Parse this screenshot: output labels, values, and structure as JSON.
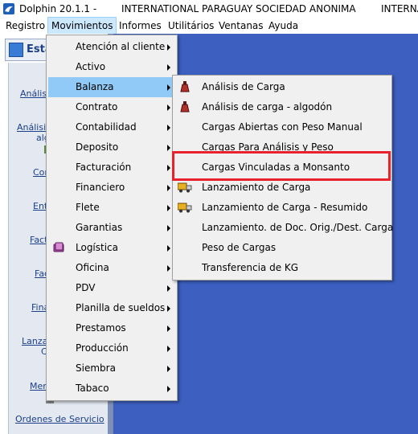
{
  "window": {
    "app_title": "Dolphin 20.1.1 -",
    "company": "INTERNATIONAL PARAGUAY SOCIEDAD ANONIMA",
    "company_truncated": "INTERNA"
  },
  "menubar": {
    "items": [
      "Registro",
      "Movimientos",
      "Informes",
      "Utilitários",
      "Ventanas",
      "Ayuda"
    ]
  },
  "sidebar": {
    "header": "Esta",
    "entries": [
      "Análisis",
      "Análisis",
      "algo",
      "Cor",
      "Entr",
      "Fact",
      "Fac",
      "Fina",
      "Lanzar",
      "C",
      "Merc",
      "Ordenes de Servicio"
    ]
  },
  "movimientos_menu": {
    "items": [
      {
        "label": "Atención al cliente",
        "submenu": true
      },
      {
        "label": "Activo",
        "submenu": true
      },
      {
        "label": "Balanza",
        "submenu": true,
        "highlight": true
      },
      {
        "label": "Contrato",
        "submenu": true
      },
      {
        "label": "Contabilidad",
        "submenu": true
      },
      {
        "label": "Deposito",
        "submenu": true
      },
      {
        "label": "Facturación",
        "submenu": true
      },
      {
        "label": "Financiero",
        "submenu": true
      },
      {
        "label": "Flete",
        "submenu": true
      },
      {
        "label": "Garantias",
        "submenu": true
      },
      {
        "label": "Logística",
        "submenu": true,
        "icon": "book-icon"
      },
      {
        "label": "Oficina",
        "submenu": true
      },
      {
        "label": "PDV",
        "submenu": true
      },
      {
        "label": "Planilla de sueldos",
        "submenu": true
      },
      {
        "label": "Prestamos",
        "submenu": true
      },
      {
        "label": "Producción",
        "submenu": true
      },
      {
        "label": "Siembra",
        "submenu": true
      },
      {
        "label": "Tabaco",
        "submenu": true
      }
    ]
  },
  "balanza_menu": {
    "items": [
      {
        "label": "Análisis de Carga",
        "icon": "flask-icon"
      },
      {
        "label": "Análisis de carga - algodón",
        "icon": "flask-icon"
      },
      {
        "label": "Cargas Abiertas con Peso Manual"
      },
      {
        "label": "Cargas Para Análisis y Peso"
      },
      {
        "label": "Cargas Vinculadas a Monsanto"
      },
      {
        "label": "Lanzamiento de Carga",
        "icon": "truck-icon"
      },
      {
        "label": "Lanzamiento de Carga - Resumido",
        "icon": "truck-icon"
      },
      {
        "label": "Lanzamiento. de Doc. Orig./Dest. Carga"
      },
      {
        "label": "Peso de Cargas"
      },
      {
        "label": "Transferencia de KG"
      }
    ]
  },
  "colors": {
    "workspace": "#3c5fc0",
    "menu_highlight": "#91c9f7",
    "annotation": "#e8212c"
  }
}
